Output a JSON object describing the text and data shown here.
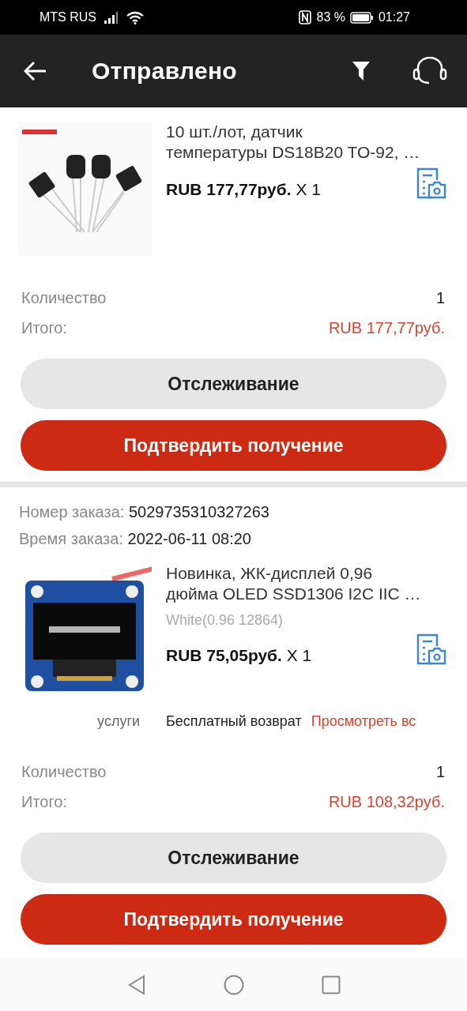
{
  "status_bar": {
    "carrier": "MTS RUS",
    "battery": "83 %",
    "time": "01:27"
  },
  "app_bar": {
    "title": "Отправлено"
  },
  "orders": [
    {
      "product": {
        "title_lines": [
          "10 шт./лот, датчик",
          "температуры DS18B20 TO-92, …"
        ],
        "price": "RUB 177,77руб.",
        "qty": "X 1"
      },
      "quantity_label": "Количество",
      "quantity": "1",
      "total_label": "Итого:",
      "total": "RUB 177,77руб.",
      "buttons": [
        {
          "label": "Отслеживание",
          "kind": "secondary"
        },
        {
          "label": "Подтвердить получение",
          "kind": "primary"
        }
      ]
    },
    {
      "order_number_label": "Номер заказа:",
      "order_number": "5029735310327263",
      "order_time_label": "Время заказа:",
      "order_time": "2022-06-11 08:20",
      "product": {
        "title_lines": [
          "Новинка, ЖК-дисплей 0,96",
          "дюйма OLED SSD1306 I2C IIC …"
        ],
        "variant": "White(0.96 12864)",
        "price": "RUB 75,05руб.",
        "qty": "X 1"
      },
      "services": {
        "label": "услуги",
        "text": "Бесплатный возврат",
        "link": "Просмотреть вс"
      },
      "quantity_label": "Количество",
      "quantity": "1",
      "total_label": "Итого:",
      "total": "RUB 108,32руб.",
      "buttons": [
        {
          "label": "Отслеживание",
          "kind": "secondary"
        },
        {
          "label": "Подтвердить получение",
          "kind": "primary"
        }
      ]
    }
  ]
}
